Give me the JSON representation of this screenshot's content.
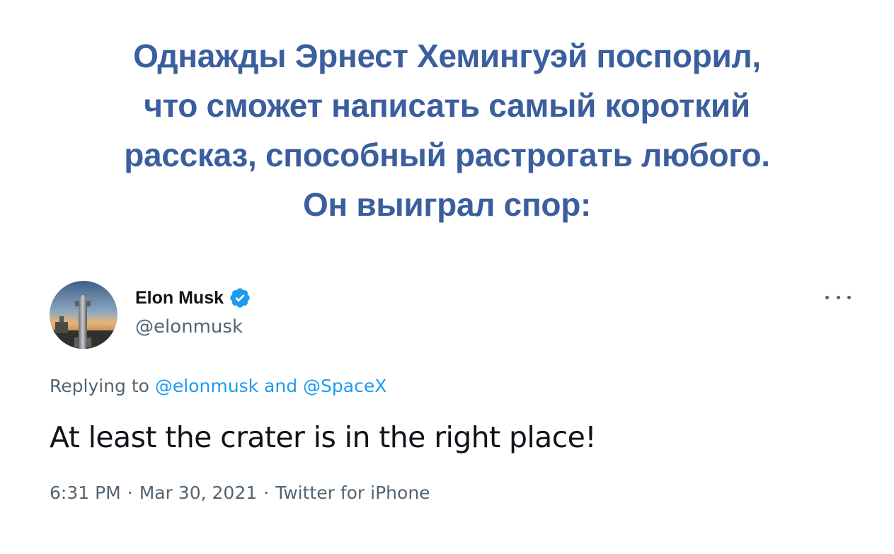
{
  "headline": {
    "lines": [
      "Однажды Эрнест Хемингуэй поспорил,",
      "что сможет написать самый короткий",
      "рассказ, способный растрогать любого.",
      "Он выиграл спор:"
    ],
    "color": "#3b5e9e"
  },
  "tweet": {
    "author_name": "Elon Musk",
    "author_handle": "@elonmusk",
    "verified": true,
    "more_icon": "more-horizontal-icon",
    "replying_to": {
      "prefix": "Replying to",
      "mention1": "@elonmusk",
      "conjunction": "and",
      "mention2": "@SpaceX"
    },
    "text": "At least the crater is in the right place!",
    "time": "6:31 PM",
    "date": "Mar 30, 2021",
    "source": "Twitter for iPhone",
    "separator": "·",
    "colors": {
      "text": "#0f1419",
      "secondary": "#536471",
      "link": "#1d9bf0",
      "verified_badge": "#1d9bf0"
    }
  }
}
